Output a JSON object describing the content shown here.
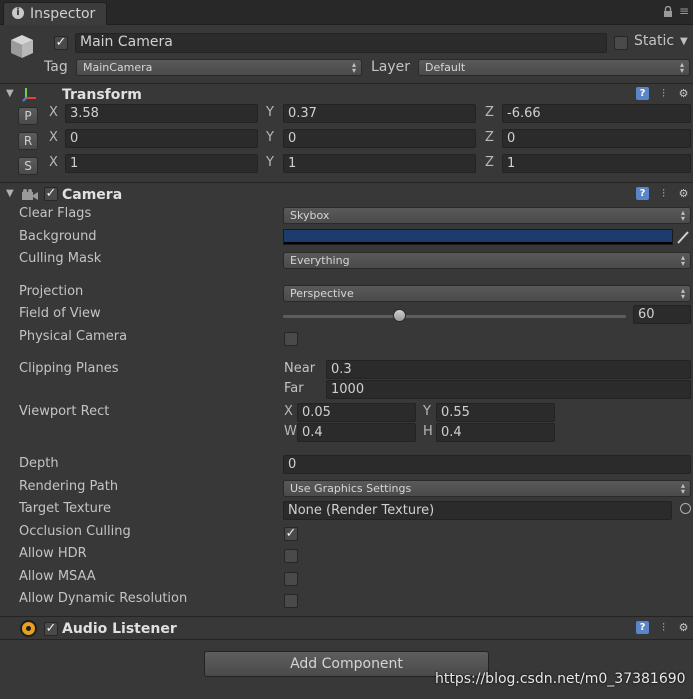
{
  "tab": {
    "icon": "info-icon",
    "label": "Inspector"
  },
  "window_controls": {
    "lock_icon": "lock-icon",
    "menu_icon": "menu-icon"
  },
  "gameobject": {
    "icon": "cube-icon",
    "active": true,
    "name": "Main Camera",
    "static_label": "Static",
    "static_checked": false,
    "tag_label": "Tag",
    "tag_value": "MainCamera",
    "layer_label": "Layer",
    "layer_value": "Default"
  },
  "transform": {
    "title": "Transform",
    "rows": [
      {
        "button": "P",
        "x": "3.58",
        "y": "0.37",
        "z": "-6.66"
      },
      {
        "button": "R",
        "x": "0",
        "y": "0",
        "z": "0"
      },
      {
        "button": "S",
        "x": "1",
        "y": "1",
        "z": "1"
      }
    ],
    "axis_x": "X",
    "axis_y": "Y",
    "axis_z": "Z"
  },
  "camera": {
    "title": "Camera",
    "enabled": true,
    "clear_flags": {
      "label": "Clear Flags",
      "value": "Skybox"
    },
    "background": {
      "label": "Background",
      "color": "#1d3c6e"
    },
    "culling_mask": {
      "label": "Culling Mask",
      "value": "Everything"
    },
    "projection": {
      "label": "Projection",
      "value": "Perspective"
    },
    "fov": {
      "label": "Field of View",
      "value": "60",
      "slider_fraction": 0.33
    },
    "physical_camera": {
      "label": "Physical Camera",
      "checked": false
    },
    "clipping": {
      "label": "Clipping Planes",
      "near_label": "Near",
      "near": "0.3",
      "far_label": "Far",
      "far": "1000"
    },
    "viewport": {
      "label": "Viewport Rect",
      "x_label": "X",
      "x": "0.05",
      "y_label": "Y",
      "y": "0.55",
      "w_label": "W",
      "w": "0.4",
      "h_label": "H",
      "h": "0.4"
    },
    "depth": {
      "label": "Depth",
      "value": "0"
    },
    "rendering_path": {
      "label": "Rendering Path",
      "value": "Use Graphics Settings"
    },
    "target_texture": {
      "label": "Target Texture",
      "value": "None (Render Texture)"
    },
    "occlusion_culling": {
      "label": "Occlusion Culling",
      "checked": true
    },
    "allow_hdr": {
      "label": "Allow HDR",
      "checked": false
    },
    "allow_msaa": {
      "label": "Allow MSAA",
      "checked": false
    },
    "allow_dynamic_resolution": {
      "label": "Allow Dynamic Resolution",
      "checked": false
    }
  },
  "audio_listener": {
    "title": "Audio Listener",
    "enabled": true
  },
  "add_component_label": "Add Component",
  "watermark": "https://blog.csdn.net/m0_37381690",
  "colors": {
    "background": "#383838",
    "field": "#2b2b2b",
    "accent_help": "#5b85c7"
  }
}
